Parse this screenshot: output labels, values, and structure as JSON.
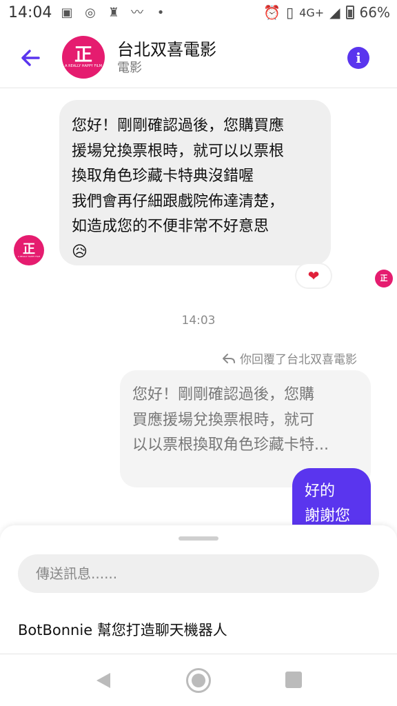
{
  "status_bar": {
    "time": "14:04",
    "network": "4G+",
    "battery": "66%"
  },
  "header": {
    "title": "台北双喜電影",
    "subtitle": "電影",
    "avatar_logo": "正",
    "avatar_caption": "A REALLY HAPPY FILM"
  },
  "messages": {
    "incoming": {
      "lines": [
        "您好！剛剛確認過後，您購買應",
        "援場兌換票根時，就可以以票根",
        "換取角色珍藏卡特典沒錯喔",
        "我們會再仔細跟戲院佈達清楚，",
        "如造成您的不便非常不好意思",
        "😥"
      ],
      "reaction": "❤"
    },
    "time_separator": "14:03",
    "reply_note": "你回覆了台北双喜電影",
    "quoted": {
      "lines": [
        "您好！剛剛確認過後，您購",
        "買應援場兌換票根時，就可",
        "以以票根換取角色珍藏卡特..."
      ]
    },
    "outgoing": {
      "lines": [
        "好的",
        "謝謝您"
      ]
    }
  },
  "composer": {
    "placeholder": "傳送訊息......"
  },
  "promo": "BotBonnie 幫您打造聊天機器人",
  "colors": {
    "accent": "#5a35ee",
    "brand": "#e51c6f",
    "bubble_in": "#efefef"
  },
  "icons": {
    "back": "arrow-left-icon",
    "info": "info-icon",
    "reply": "reply-icon"
  }
}
